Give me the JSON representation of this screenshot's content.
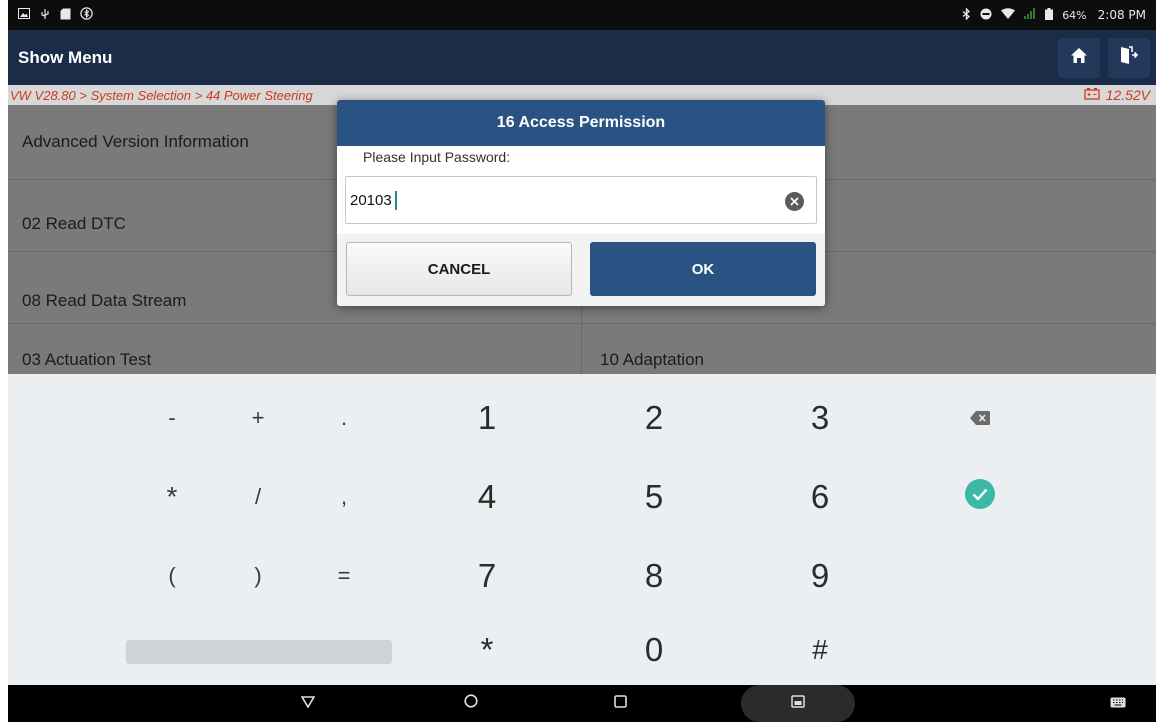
{
  "status_bar": {
    "icons_left": [
      "image-icon",
      "usb-icon",
      "sd-card-icon",
      "bluetooth-scan-icon"
    ],
    "icons_right": [
      "bluetooth-icon",
      "do-not-disturb-icon",
      "wifi-icon",
      "signal-icon",
      "battery-icon"
    ],
    "battery": "64%",
    "time": "2:08 PM"
  },
  "header": {
    "title": "Show Menu",
    "home_icon": "home-icon",
    "exit_icon": "exit-icon"
  },
  "breadcrumb": {
    "path": "VW V28.80 > System Selection > 44 Power Steering",
    "voltage": "12.52V",
    "color": "#cc3b1c"
  },
  "menu": {
    "items_left": [
      "Advanced Version Information",
      "02 Read DTC",
      "08 Read Data Stream",
      "03 Actuation Test"
    ],
    "items_right": [
      "",
      "",
      "",
      "10 Adaptation"
    ]
  },
  "dialog": {
    "title": "16 Access Permission",
    "prompt": "Please Input Password:",
    "value": "20103",
    "cancel_label": "CANCEL",
    "ok_label": "OK",
    "accent": "#2a5384"
  },
  "keyboard": {
    "row1": [
      "-",
      "+",
      ".",
      "1",
      "2",
      "3"
    ],
    "row2": [
      "*",
      "/",
      ",",
      "4",
      "5",
      "6"
    ],
    "row3": [
      "(",
      ")",
      "=",
      "7",
      "8",
      "9"
    ],
    "row4": [
      "*",
      "0",
      "#"
    ],
    "backspace_icon": "backspace-icon",
    "enter_icon": "check-circle-icon",
    "enter_color": "#3bb8a8"
  },
  "nav_bar": {
    "icons": [
      "back-triangle-icon",
      "home-circle-icon",
      "recents-square-icon",
      "screenshot-icon",
      "keyboard-icon"
    ]
  }
}
